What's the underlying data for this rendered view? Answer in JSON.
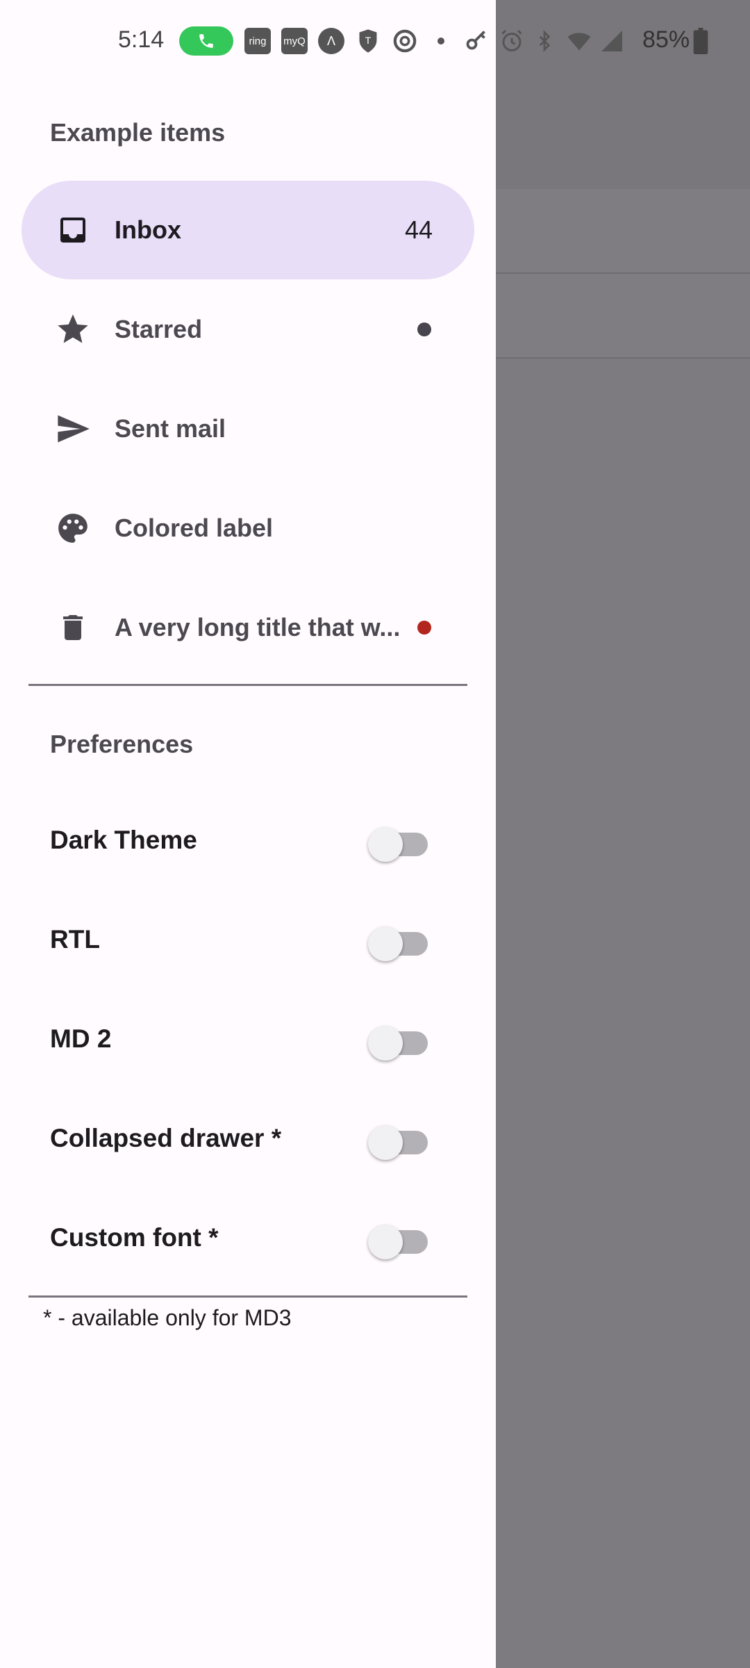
{
  "status_bar": {
    "time": "5:14",
    "battery": "85%",
    "icons": [
      "phone-icon",
      "ring-icon",
      "myq-icon",
      "arlo-icon",
      "tmobile-icon",
      "chrome-icon",
      "dot-icon",
      "key-icon",
      "alarm-icon",
      "bluetooth-icon",
      "wifi-icon",
      "signal-icon",
      "battery-icon"
    ],
    "ring_label": "ring",
    "myq_label": "myQ"
  },
  "drawer": {
    "section_title": "Example items",
    "items": [
      {
        "label": "Inbox",
        "badge": "44",
        "icon": "inbox-icon",
        "active": true
      },
      {
        "label": "Starred",
        "icon": "star-icon",
        "indicator_color": "#49454f"
      },
      {
        "label": "Sent mail",
        "icon": "send-icon"
      },
      {
        "label": "Colored label",
        "icon": "palette-icon"
      },
      {
        "label": "A very long title that w...",
        "icon": "trash-icon",
        "indicator_color": "#b3261e"
      }
    ],
    "preferences_title": "Preferences",
    "preferences": [
      {
        "label": "Dark Theme",
        "enabled": false
      },
      {
        "label": "RTL",
        "enabled": false
      },
      {
        "label": "MD 2",
        "enabled": false
      },
      {
        "label": "Collapsed drawer *",
        "enabled": false
      },
      {
        "label": "Custom font *",
        "enabled": false
      }
    ],
    "footnote": "* - available only for MD3"
  },
  "colors": {
    "drawer_bg": "#fffbfe",
    "active_pill": "#e8def8",
    "scrim": "#7d7b80",
    "accent_call": "#34c759"
  }
}
